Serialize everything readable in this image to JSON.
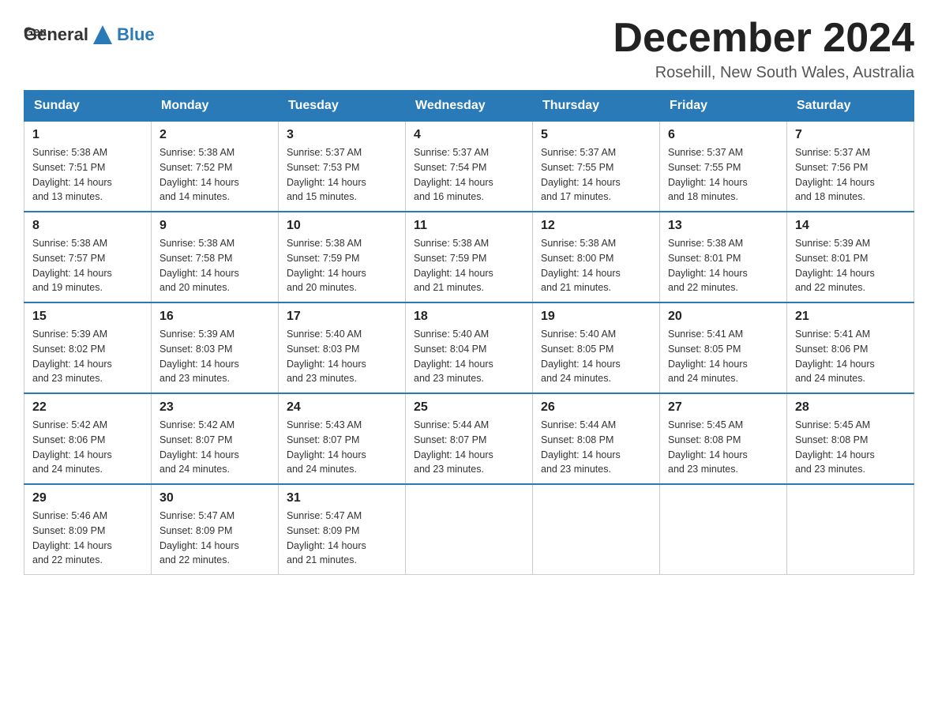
{
  "header": {
    "logo_general": "General",
    "logo_blue": "Blue",
    "month_title": "December 2024",
    "location": "Rosehill, New South Wales, Australia"
  },
  "weekdays": [
    "Sunday",
    "Monday",
    "Tuesday",
    "Wednesday",
    "Thursday",
    "Friday",
    "Saturday"
  ],
  "weeks": [
    [
      {
        "day": "1",
        "sunrise": "5:38 AM",
        "sunset": "7:51 PM",
        "daylight": "14 hours and 13 minutes."
      },
      {
        "day": "2",
        "sunrise": "5:38 AM",
        "sunset": "7:52 PM",
        "daylight": "14 hours and 14 minutes."
      },
      {
        "day": "3",
        "sunrise": "5:37 AM",
        "sunset": "7:53 PM",
        "daylight": "14 hours and 15 minutes."
      },
      {
        "day": "4",
        "sunrise": "5:37 AM",
        "sunset": "7:54 PM",
        "daylight": "14 hours and 16 minutes."
      },
      {
        "day": "5",
        "sunrise": "5:37 AM",
        "sunset": "7:55 PM",
        "daylight": "14 hours and 17 minutes."
      },
      {
        "day": "6",
        "sunrise": "5:37 AM",
        "sunset": "7:55 PM",
        "daylight": "14 hours and 18 minutes."
      },
      {
        "day": "7",
        "sunrise": "5:37 AM",
        "sunset": "7:56 PM",
        "daylight": "14 hours and 18 minutes."
      }
    ],
    [
      {
        "day": "8",
        "sunrise": "5:38 AM",
        "sunset": "7:57 PM",
        "daylight": "14 hours and 19 minutes."
      },
      {
        "day": "9",
        "sunrise": "5:38 AM",
        "sunset": "7:58 PM",
        "daylight": "14 hours and 20 minutes."
      },
      {
        "day": "10",
        "sunrise": "5:38 AM",
        "sunset": "7:59 PM",
        "daylight": "14 hours and 20 minutes."
      },
      {
        "day": "11",
        "sunrise": "5:38 AM",
        "sunset": "7:59 PM",
        "daylight": "14 hours and 21 minutes."
      },
      {
        "day": "12",
        "sunrise": "5:38 AM",
        "sunset": "8:00 PM",
        "daylight": "14 hours and 21 minutes."
      },
      {
        "day": "13",
        "sunrise": "5:38 AM",
        "sunset": "8:01 PM",
        "daylight": "14 hours and 22 minutes."
      },
      {
        "day": "14",
        "sunrise": "5:39 AM",
        "sunset": "8:01 PM",
        "daylight": "14 hours and 22 minutes."
      }
    ],
    [
      {
        "day": "15",
        "sunrise": "5:39 AM",
        "sunset": "8:02 PM",
        "daylight": "14 hours and 23 minutes."
      },
      {
        "day": "16",
        "sunrise": "5:39 AM",
        "sunset": "8:03 PM",
        "daylight": "14 hours and 23 minutes."
      },
      {
        "day": "17",
        "sunrise": "5:40 AM",
        "sunset": "8:03 PM",
        "daylight": "14 hours and 23 minutes."
      },
      {
        "day": "18",
        "sunrise": "5:40 AM",
        "sunset": "8:04 PM",
        "daylight": "14 hours and 23 minutes."
      },
      {
        "day": "19",
        "sunrise": "5:40 AM",
        "sunset": "8:05 PM",
        "daylight": "14 hours and 24 minutes."
      },
      {
        "day": "20",
        "sunrise": "5:41 AM",
        "sunset": "8:05 PM",
        "daylight": "14 hours and 24 minutes."
      },
      {
        "day": "21",
        "sunrise": "5:41 AM",
        "sunset": "8:06 PM",
        "daylight": "14 hours and 24 minutes."
      }
    ],
    [
      {
        "day": "22",
        "sunrise": "5:42 AM",
        "sunset": "8:06 PM",
        "daylight": "14 hours and 24 minutes."
      },
      {
        "day": "23",
        "sunrise": "5:42 AM",
        "sunset": "8:07 PM",
        "daylight": "14 hours and 24 minutes."
      },
      {
        "day": "24",
        "sunrise": "5:43 AM",
        "sunset": "8:07 PM",
        "daylight": "14 hours and 24 minutes."
      },
      {
        "day": "25",
        "sunrise": "5:44 AM",
        "sunset": "8:07 PM",
        "daylight": "14 hours and 23 minutes."
      },
      {
        "day": "26",
        "sunrise": "5:44 AM",
        "sunset": "8:08 PM",
        "daylight": "14 hours and 23 minutes."
      },
      {
        "day": "27",
        "sunrise": "5:45 AM",
        "sunset": "8:08 PM",
        "daylight": "14 hours and 23 minutes."
      },
      {
        "day": "28",
        "sunrise": "5:45 AM",
        "sunset": "8:08 PM",
        "daylight": "14 hours and 23 minutes."
      }
    ],
    [
      {
        "day": "29",
        "sunrise": "5:46 AM",
        "sunset": "8:09 PM",
        "daylight": "14 hours and 22 minutes."
      },
      {
        "day": "30",
        "sunrise": "5:47 AM",
        "sunset": "8:09 PM",
        "daylight": "14 hours and 22 minutes."
      },
      {
        "day": "31",
        "sunrise": "5:47 AM",
        "sunset": "8:09 PM",
        "daylight": "14 hours and 21 minutes."
      },
      null,
      null,
      null,
      null
    ]
  ]
}
